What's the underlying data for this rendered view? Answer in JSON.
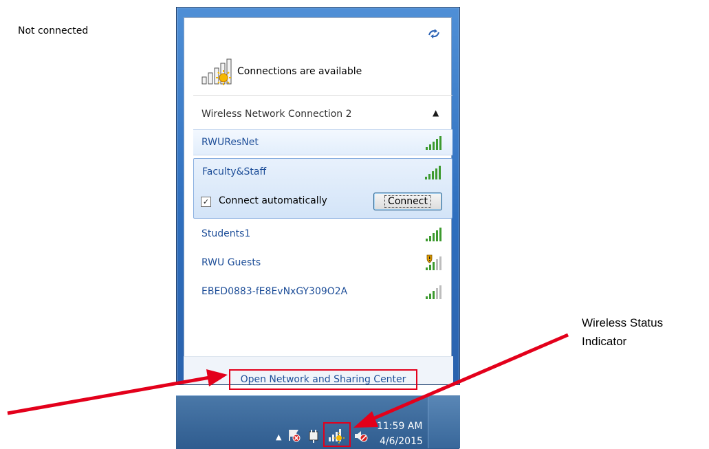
{
  "flyout": {
    "status_title": "Not connected",
    "connections_text": "Connections are available",
    "group_label": "Wireless Network Connection 2",
    "networks": [
      {
        "name": "RWUResNet",
        "signal_bars": 5,
        "secured_warning": false
      },
      {
        "name": "Faculty&Staff",
        "signal_bars": 5,
        "secured_warning": false
      },
      {
        "name": "Students1",
        "signal_bars": 5,
        "secured_warning": false
      },
      {
        "name": "RWU Guests",
        "signal_bars": 3,
        "secured_warning": true
      },
      {
        "name": "EBED0883-fE8EvNxGY309O2A",
        "signal_bars": 3,
        "secured_warning": false
      }
    ],
    "selected_network": {
      "connect_auto_label": "Connect automatically",
      "connect_auto_checked": true,
      "connect_button_label": "Connect"
    },
    "footer_link": "Open Network and Sharing Center"
  },
  "taskbar": {
    "time": "11:59 AM",
    "date": "4/6/2015"
  },
  "annotation": {
    "callout_text_line1": "Wireless Status",
    "callout_text_line2": "Indicator"
  },
  "colors": {
    "link": "#1f4f99",
    "highlight_box": "#e3001b",
    "signal_green": "#3d9a2f"
  }
}
